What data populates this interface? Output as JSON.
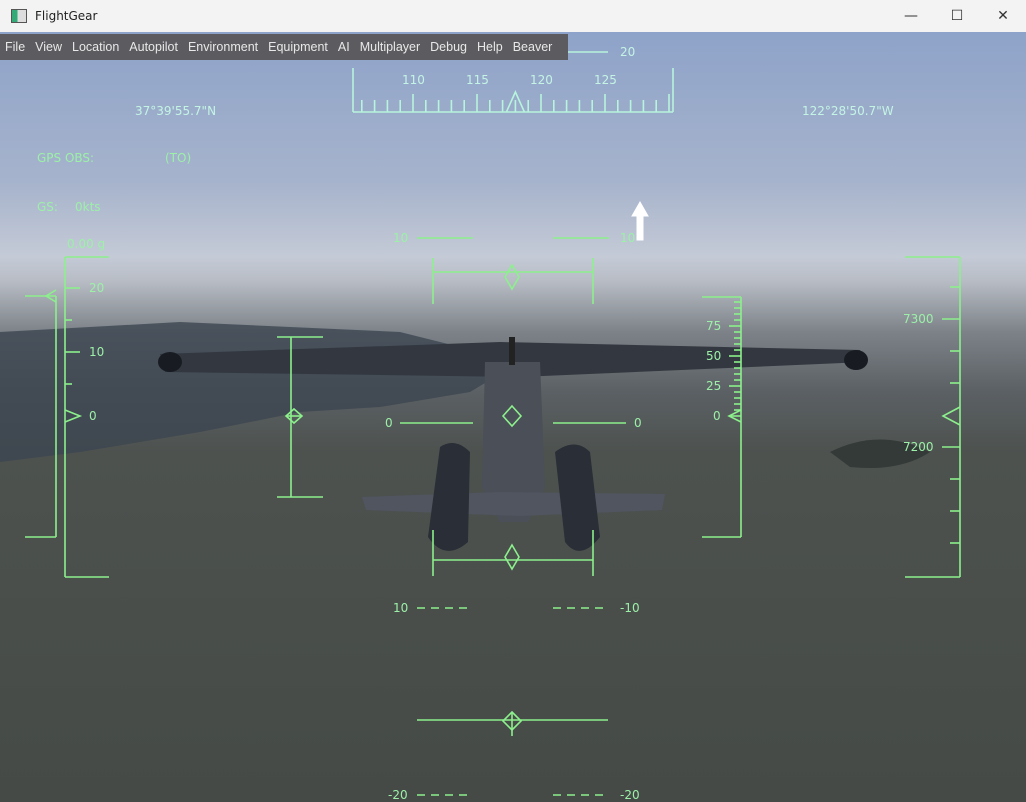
{
  "window": {
    "title": "FlightGear",
    "minimize": "—",
    "maximize": "☐",
    "close": "✕",
    "icon": "flightgear-app-icon"
  },
  "menu": [
    "File",
    "View",
    "Location",
    "Autopilot",
    "Environment",
    "Equipment",
    "AI",
    "Multiplayer",
    "Debug",
    "Help",
    "Beaver"
  ],
  "hud": {
    "color": "#8cf08c",
    "heading": {
      "labels": [
        "110",
        "115",
        "120",
        "125"
      ],
      "value": 118,
      "bank_label": "20"
    },
    "latitude": "37°39'55.7\"N",
    "longitude": "122°28'50.7\"W",
    "gps_obs_label": "GPS OBS:",
    "gps_obs_value": "(TO)",
    "gs_label": "GS:",
    "gs_value": "0kts",
    "g_load": "0.00 g",
    "g_scale": [
      "20",
      "10",
      "0"
    ],
    "pitch_ladder": {
      "p10_left": "10",
      "p10_right": "10",
      "p0_left": "0",
      "p0_right": "0",
      "m10_left": "10",
      "m10_right": "-10",
      "m20_left": "-20",
      "m20_right": "-20"
    },
    "speed_scale": [
      "75",
      "50",
      "25",
      "0"
    ],
    "speed_value": 0,
    "altitude_scale": [
      "7300",
      "7200"
    ],
    "altitude_value": 7240
  }
}
